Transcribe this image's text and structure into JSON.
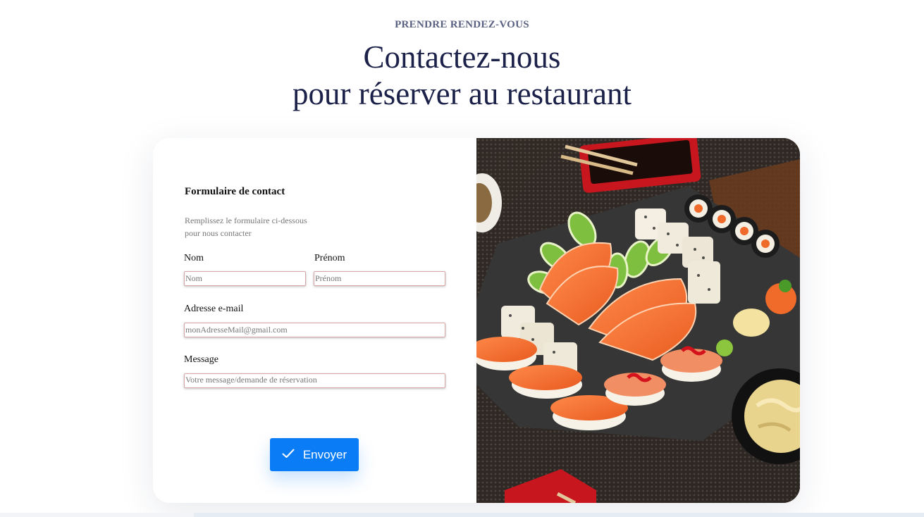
{
  "header": {
    "eyebrow": "PRENDRE RENDEZ-VOUS",
    "title_line1": "Contactez-nous",
    "title_line2": "pour réserver au restaurant"
  },
  "form": {
    "title": "Formulaire de contact",
    "subtitle_line1": "Remplissez le formulaire ci-dessous",
    "subtitle_line2": "pour nous contacter",
    "nom": {
      "label": "Nom",
      "placeholder": "Nom",
      "value": ""
    },
    "prenom": {
      "label": "Prénom",
      "placeholder": "Prénom",
      "value": ""
    },
    "email": {
      "label": "Adresse e-mail",
      "placeholder": "monAdresseMail@gmail.com",
      "value": ""
    },
    "message": {
      "label": "Message",
      "placeholder": "Votre message/demande de réservation",
      "value": ""
    },
    "submit": {
      "label": "Envoyer",
      "icon": "check-icon"
    }
  },
  "image": {
    "subject": "sushi-platter",
    "icon": "sushi-photo"
  },
  "colors": {
    "primary": "#0a7cf5",
    "heading": "#1b2148",
    "eyebrow": "#5a6181",
    "field_border": "#d9a6a6"
  }
}
